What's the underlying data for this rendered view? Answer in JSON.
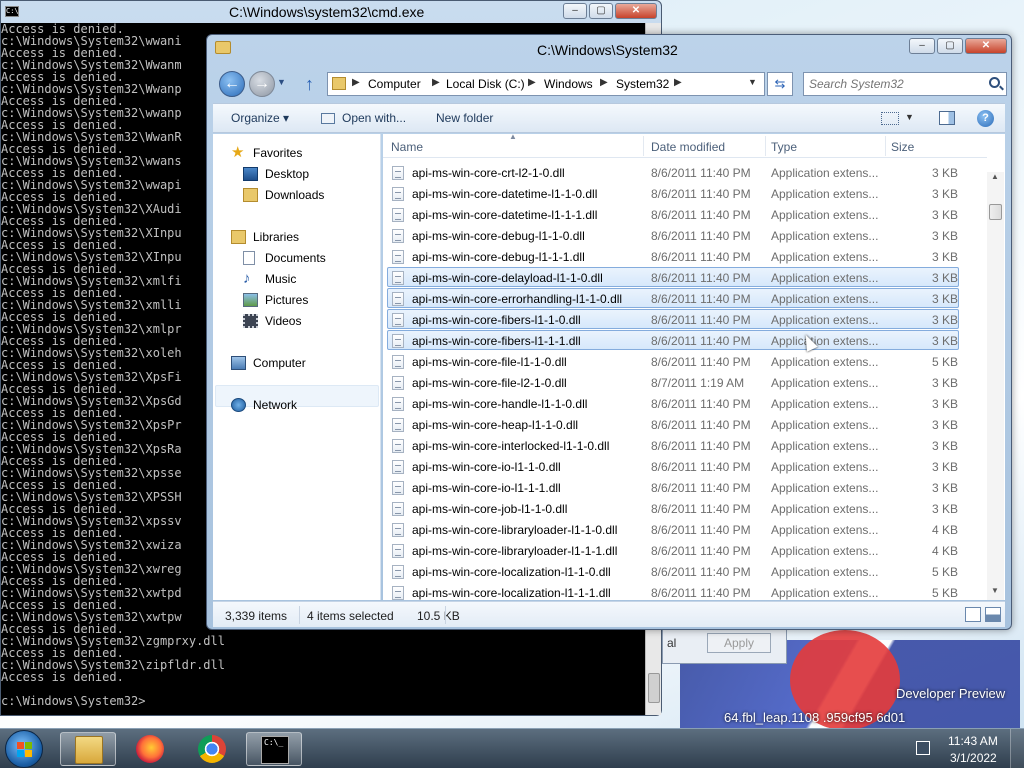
{
  "desktop": {
    "text_line_1": "Developer Preview",
    "text_line_2": "64.fbl_leap.1108",
    "text_line_3": ".959cf95",
    "text_line_4": "6d01"
  },
  "cmd_window": {
    "title": "C:\\Windows\\system32\\cmd.exe",
    "minimize": "–",
    "maximize": "▢",
    "close": "✕",
    "lines": [
      "Access is denied.",
      "c:\\Windows\\System32\\wwani",
      "Access is denied.",
      "c:\\Windows\\System32\\Wwanm",
      "Access is denied.",
      "c:\\Windows\\System32\\Wwanp",
      "Access is denied.",
      "c:\\Windows\\System32\\wwanp",
      "Access is denied.",
      "c:\\Windows\\System32\\WwanR",
      "Access is denied.",
      "c:\\Windows\\System32\\wwans",
      "Access is denied.",
      "c:\\Windows\\System32\\wwapi",
      "Access is denied.",
      "c:\\Windows\\System32\\XAudi",
      "Access is denied.",
      "c:\\Windows\\System32\\XInpu",
      "Access is denied.",
      "c:\\Windows\\System32\\XInpu",
      "Access is denied.",
      "c:\\Windows\\System32\\xmlfi",
      "Access is denied.",
      "c:\\Windows\\System32\\xmlli",
      "Access is denied.",
      "c:\\Windows\\System32\\xmlpr",
      "Access is denied.",
      "c:\\Windows\\System32\\xoleh",
      "Access is denied.",
      "c:\\Windows\\System32\\XpsFi",
      "Access is denied.",
      "c:\\Windows\\System32\\XpsGd",
      "Access is denied.",
      "c:\\Windows\\System32\\XpsPr",
      "Access is denied.",
      "c:\\Windows\\System32\\XpsRa",
      "Access is denied.",
      "c:\\Windows\\System32\\xpsse",
      "Access is denied.",
      "c:\\Windows\\System32\\XPSSH",
      "Access is denied.",
      "c:\\Windows\\System32\\xpssv",
      "Access is denied.",
      "c:\\Windows\\System32\\xwiza",
      "Access is denied.",
      "c:\\Windows\\System32\\xwreg",
      "Access is denied.",
      "c:\\Windows\\System32\\xwtpd",
      "Access is denied.",
      "c:\\Windows\\System32\\xwtpw",
      "Access is denied.",
      "c:\\Windows\\System32\\zgmprxy.dll",
      "Access is denied.",
      "c:\\Windows\\System32\\zipfldr.dll",
      "Access is denied.",
      "",
      "c:\\Windows\\System32>"
    ]
  },
  "explorer": {
    "title": "C:\\Windows\\System32",
    "minimize": "–",
    "maximize": "▢",
    "close": "✕",
    "back_glyph": "←",
    "forward_glyph": "→",
    "up_glyph": "↑",
    "breadcrumb": [
      "Computer",
      "Local Disk (C:)",
      "Windows",
      "System32"
    ],
    "refresh_glyph": "⇆",
    "search_placeholder": "Search System32",
    "toolbar": {
      "organize": "Organize ▾",
      "open_with": "Open with...",
      "new_folder": "New folder",
      "help": "?"
    },
    "nav": {
      "favorites": "Favorites",
      "desktop": "Desktop",
      "downloads": "Downloads",
      "libraries": "Libraries",
      "documents": "Documents",
      "music": "Music",
      "pictures": "Pictures",
      "videos": "Videos",
      "computer": "Computer",
      "network": "Network"
    },
    "columns": {
      "name": "Name",
      "date": "Date modified",
      "type": "Type",
      "size": "Size"
    },
    "files": [
      {
        "name": "api-ms-win-core-crt-l2-1-0.dll",
        "date": "8/6/2011 11:40 PM",
        "type": "Application extens...",
        "size": "3 KB",
        "selected": false
      },
      {
        "name": "api-ms-win-core-datetime-l1-1-0.dll",
        "date": "8/6/2011 11:40 PM",
        "type": "Application extens...",
        "size": "3 KB",
        "selected": false
      },
      {
        "name": "api-ms-win-core-datetime-l1-1-1.dll",
        "date": "8/6/2011 11:40 PM",
        "type": "Application extens...",
        "size": "3 KB",
        "selected": false
      },
      {
        "name": "api-ms-win-core-debug-l1-1-0.dll",
        "date": "8/6/2011 11:40 PM",
        "type": "Application extens...",
        "size": "3 KB",
        "selected": false
      },
      {
        "name": "api-ms-win-core-debug-l1-1-1.dll",
        "date": "8/6/2011 11:40 PM",
        "type": "Application extens...",
        "size": "3 KB",
        "selected": false
      },
      {
        "name": "api-ms-win-core-delayload-l1-1-0.dll",
        "date": "8/6/2011 11:40 PM",
        "type": "Application extens...",
        "size": "3 KB",
        "selected": true
      },
      {
        "name": "api-ms-win-core-errorhandling-l1-1-0.dll",
        "date": "8/6/2011 11:40 PM",
        "type": "Application extens...",
        "size": "3 KB",
        "selected": true
      },
      {
        "name": "api-ms-win-core-fibers-l1-1-0.dll",
        "date": "8/6/2011 11:40 PM",
        "type": "Application extens...",
        "size": "3 KB",
        "selected": true
      },
      {
        "name": "api-ms-win-core-fibers-l1-1-1.dll",
        "date": "8/6/2011 11:40 PM",
        "type": "Application extens...",
        "size": "3 KB",
        "selected": true
      },
      {
        "name": "api-ms-win-core-file-l1-1-0.dll",
        "date": "8/6/2011 11:40 PM",
        "type": "Application extens...",
        "size": "5 KB",
        "selected": false
      },
      {
        "name": "api-ms-win-core-file-l2-1-0.dll",
        "date": "8/7/2011 1:19 AM",
        "type": "Application extens...",
        "size": "3 KB",
        "selected": false
      },
      {
        "name": "api-ms-win-core-handle-l1-1-0.dll",
        "date": "8/6/2011 11:40 PM",
        "type": "Application extens...",
        "size": "3 KB",
        "selected": false
      },
      {
        "name": "api-ms-win-core-heap-l1-1-0.dll",
        "date": "8/6/2011 11:40 PM",
        "type": "Application extens...",
        "size": "3 KB",
        "selected": false
      },
      {
        "name": "api-ms-win-core-interlocked-l1-1-0.dll",
        "date": "8/6/2011 11:40 PM",
        "type": "Application extens...",
        "size": "3 KB",
        "selected": false
      },
      {
        "name": "api-ms-win-core-io-l1-1-0.dll",
        "date": "8/6/2011 11:40 PM",
        "type": "Application extens...",
        "size": "3 KB",
        "selected": false
      },
      {
        "name": "api-ms-win-core-io-l1-1-1.dll",
        "date": "8/6/2011 11:40 PM",
        "type": "Application extens...",
        "size": "3 KB",
        "selected": false
      },
      {
        "name": "api-ms-win-core-job-l1-1-0.dll",
        "date": "8/6/2011 11:40 PM",
        "type": "Application extens...",
        "size": "3 KB",
        "selected": false
      },
      {
        "name": "api-ms-win-core-libraryloader-l1-1-0.dll",
        "date": "8/6/2011 11:40 PM",
        "type": "Application extens...",
        "size": "4 KB",
        "selected": false
      },
      {
        "name": "api-ms-win-core-libraryloader-l1-1-1.dll",
        "date": "8/6/2011 11:40 PM",
        "type": "Application extens...",
        "size": "4 KB",
        "selected": false
      },
      {
        "name": "api-ms-win-core-localization-l1-1-0.dll",
        "date": "8/6/2011 11:40 PM",
        "type": "Application extens...",
        "size": "5 KB",
        "selected": false
      },
      {
        "name": "api-ms-win-core-localization-l1-1-1.dll",
        "date": "8/6/2011 11:40 PM",
        "type": "Application extens...",
        "size": "5 KB",
        "selected": false
      }
    ],
    "status": {
      "item_count": "3,339 items",
      "selection": "4 items selected",
      "selection_size": "10.5 KB"
    }
  },
  "background_dialog": {
    "cut_label": "al",
    "apply": "Apply"
  },
  "taskbar": {
    "cmd_label": "C:\\_",
    "time": "11:43 AM",
    "date": "3/1/2022"
  },
  "colors": {
    "selection_fill": "#d6e8fb",
    "selection_border": "#84acdd",
    "console_bg": "#000000",
    "console_text": "#c0c0c0"
  }
}
